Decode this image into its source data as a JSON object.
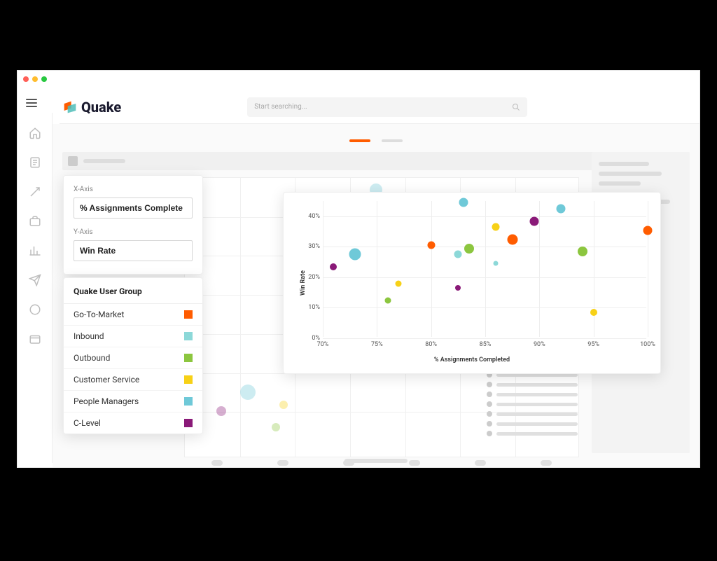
{
  "app": {
    "name": "Quake"
  },
  "search": {
    "placeholder": "Start searching..."
  },
  "axis_config": {
    "x_label": "X-Axis",
    "x_value": "% Assignments Complete",
    "y_label": "Y-Axis",
    "y_value": "Win Rate"
  },
  "legend": {
    "title": "Quake User Group",
    "items": [
      {
        "label": "Go-To-Market",
        "color": "#ff5c00"
      },
      {
        "label": "Inbound",
        "color": "#8cd8d8"
      },
      {
        "label": "Outbound",
        "color": "#8cc63f"
      },
      {
        "label": "Customer Service",
        "color": "#f7d117"
      },
      {
        "label": "People Managers",
        "color": "#6fc9d8"
      },
      {
        "label": "C-Level",
        "color": "#8a1a78"
      }
    ]
  },
  "chart_data": {
    "type": "scatter",
    "xlabel": "% Assignments Completed",
    "ylabel": "Win Rate",
    "xlim": [
      70,
      100
    ],
    "ylim": [
      0,
      45
    ],
    "x_ticks": [
      "70%",
      "75%",
      "80%",
      "85%",
      "90%",
      "95%",
      "100%"
    ],
    "y_ticks": [
      "0%",
      "10%",
      "20%",
      "30%",
      "40%"
    ],
    "series": [
      {
        "name": "Go-To-Market",
        "color": "#ff5c00",
        "points": [
          [
            80,
            30,
            11
          ],
          [
            87.5,
            32,
            15
          ],
          [
            100,
            35,
            13
          ]
        ]
      },
      {
        "name": "Inbound",
        "color": "#8cd8d8",
        "points": [
          [
            82.5,
            27,
            11
          ],
          [
            86,
            24,
            7
          ]
        ]
      },
      {
        "name": "Outbound",
        "color": "#8cc63f",
        "points": [
          [
            76,
            12,
            9
          ],
          [
            83.5,
            29,
            14
          ],
          [
            94,
            28,
            14
          ]
        ]
      },
      {
        "name": "Customer Service",
        "color": "#f7d117",
        "points": [
          [
            77,
            17.5,
            9
          ],
          [
            86,
            36,
            11
          ],
          [
            95,
            8,
            10
          ]
        ]
      },
      {
        "name": "People Managers",
        "color": "#6fc9d8",
        "points": [
          [
            73,
            27,
            17
          ],
          [
            83,
            44,
            13
          ],
          [
            92,
            42,
            13
          ]
        ]
      },
      {
        "name": "C-Level",
        "color": "#8a1a78",
        "points": [
          [
            71,
            23,
            10
          ],
          [
            82.5,
            16,
            8
          ],
          [
            89.5,
            38,
            13
          ]
        ]
      }
    ]
  }
}
